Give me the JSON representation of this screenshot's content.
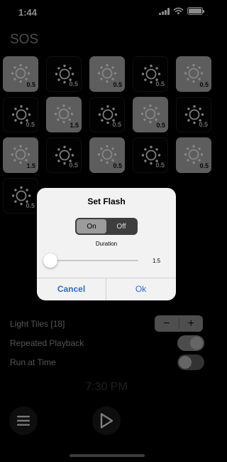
{
  "status_bar": {
    "time": "1:44",
    "icons": [
      "cellular-signal-icon",
      "wifi-icon",
      "battery-icon"
    ]
  },
  "app": {
    "title": "SOS"
  },
  "tiles": [
    {
      "state": "on",
      "value": "0.5"
    },
    {
      "state": "off",
      "value": "0.5"
    },
    {
      "state": "on",
      "value": "0.5"
    },
    {
      "state": "off",
      "value": "0.5"
    },
    {
      "state": "on",
      "value": "0.5"
    },
    {
      "state": "off",
      "value": "0.5"
    },
    {
      "state": "on",
      "value": "1.5"
    },
    {
      "state": "off",
      "value": "0.5"
    },
    {
      "state": "on",
      "value": "0.5"
    },
    {
      "state": "off",
      "value": "0.5"
    },
    {
      "state": "on",
      "value": "1.5"
    },
    {
      "state": "off",
      "value": "0.5"
    },
    {
      "state": "on",
      "value": "0.5"
    },
    {
      "state": "off",
      "value": "0.5"
    },
    {
      "state": "on",
      "value": "0.5"
    },
    {
      "state": "off",
      "value": "0.5"
    }
  ],
  "settings": {
    "light_tiles_label": "Light Tiles [18]",
    "stepper_minus": "−",
    "stepper_plus": "+",
    "repeated_playback_label": "Repeated Playback",
    "repeated_playback_on": true,
    "run_at_time_label": "Run at Time",
    "run_at_time_on": false,
    "time_value": "7:30 PM"
  },
  "toolbar": {
    "menu_icon": "menu-icon",
    "play_icon": "play-icon"
  },
  "dialog": {
    "title": "Set Flash",
    "segment_on": "On",
    "segment_off": "Off",
    "selected_segment": "On",
    "duration_label": "Duration",
    "duration_value": "1.5",
    "slider_fraction": 0.07,
    "cancel_label": "Cancel",
    "ok_label": "Ok"
  },
  "colors": {
    "accent": "#2a6fd6",
    "tile_on": "#a9a9a9",
    "tile_off": "#050505"
  }
}
